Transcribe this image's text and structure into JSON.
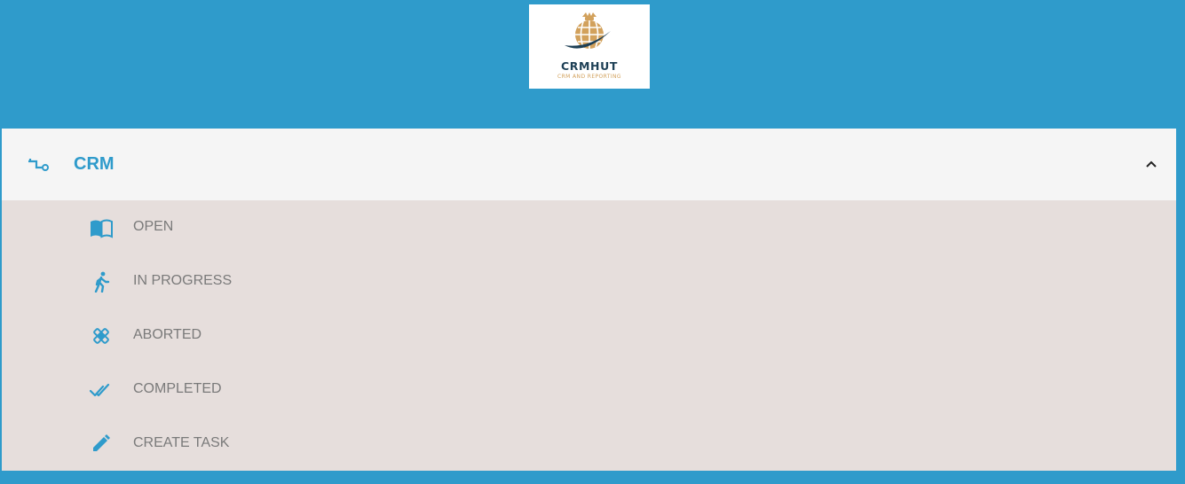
{
  "logo": {
    "name": "CRMHUT",
    "tagline": "CRM AND REPORTING"
  },
  "colors": {
    "background": "#2f9bcb",
    "accent": "#2f9bcb",
    "header_bg": "#f5f5f5",
    "body_bg": "#e6dedc",
    "item_text": "#7a7a7a",
    "logo_gold": "#d2a15c",
    "logo_navy": "#1d3f55"
  },
  "panel": {
    "title": "CRM",
    "header_icon": "crm-flow-icon",
    "toggle_icon": "chevron-up-icon",
    "expanded": true,
    "items": [
      {
        "label": "OPEN",
        "icon": "book-open-icon"
      },
      {
        "label": "IN PROGRESS",
        "icon": "walk-icon"
      },
      {
        "label": "ABORTED",
        "icon": "crossed-tools-icon"
      },
      {
        "label": "COMPLETED",
        "icon": "double-check-icon"
      },
      {
        "label": "CREATE TASK",
        "icon": "pencil-icon"
      }
    ]
  }
}
